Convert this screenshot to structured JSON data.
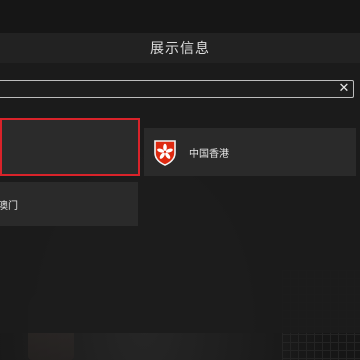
{
  "header": {
    "title": "展示信息"
  },
  "search": {
    "value": "",
    "placeholder": ""
  },
  "clear_icon": "close-icon",
  "regions": [
    {
      "label": "",
      "selected": true
    },
    {
      "label": "中国香港",
      "icon": "hong-kong-flag-icon",
      "selected": false
    },
    {
      "label": "澳门",
      "selected": false
    }
  ],
  "colors": {
    "selection_border": "#d9232a",
    "flag_red": "#de2910"
  }
}
